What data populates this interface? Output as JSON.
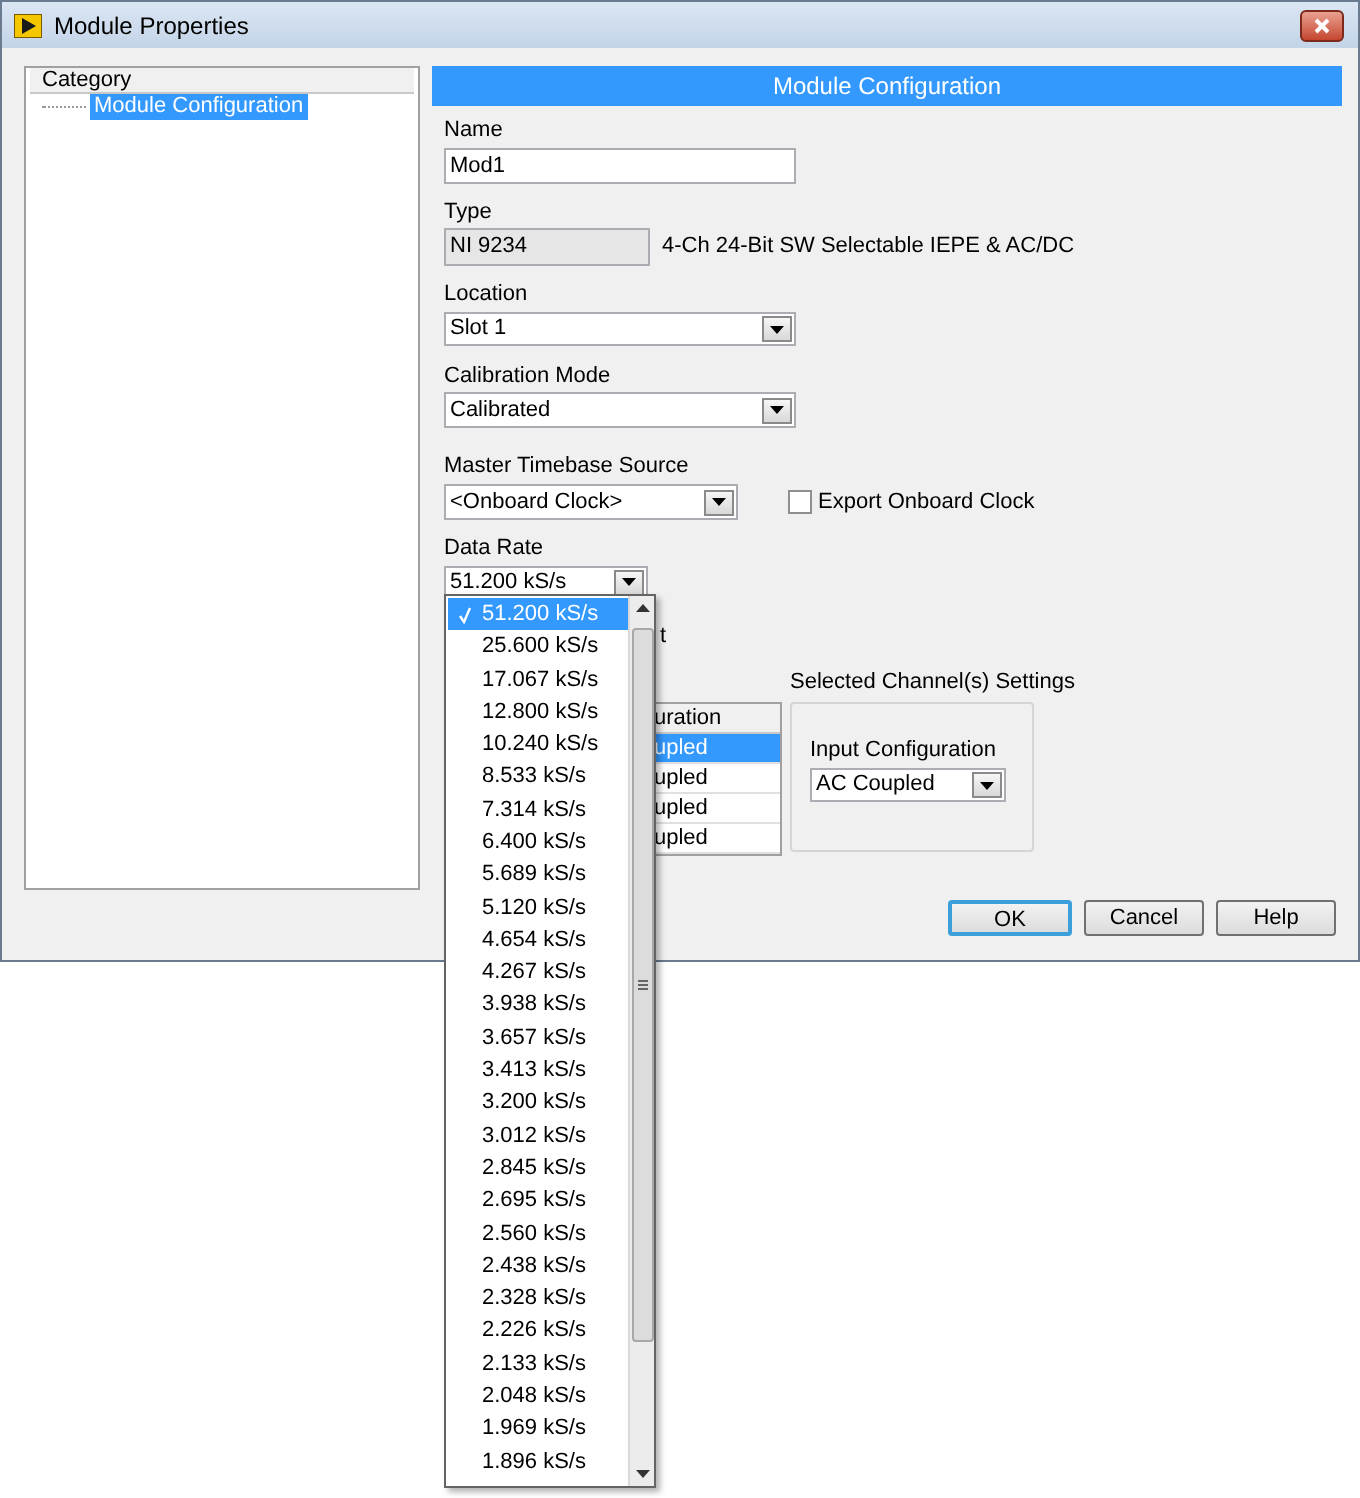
{
  "window": {
    "title": "Module Properties"
  },
  "category_panel": {
    "header": "Category",
    "items": [
      {
        "label": "Module Configuration",
        "selected": true
      }
    ]
  },
  "section_header": "Module Configuration",
  "name": {
    "label": "Name",
    "value": "Mod1"
  },
  "type": {
    "label": "Type",
    "value": "NI 9234",
    "description": "4-Ch 24-Bit SW Selectable IEPE & AC/DC"
  },
  "location": {
    "label": "Location",
    "value": "Slot 1"
  },
  "calibration_mode": {
    "label": "Calibration Mode",
    "value": "Calibrated"
  },
  "master_timebase": {
    "label": "Master Timebase Source",
    "value": "<Onboard Clock>"
  },
  "export_clock": {
    "label": "Export Onboard Clock",
    "checked": false
  },
  "data_rate": {
    "label": "Data Rate",
    "value": "51.200 kS/s",
    "options": [
      {
        "label": "51.200 kS/s",
        "selected": true
      },
      {
        "label": "25.600 kS/s",
        "selected": false
      },
      {
        "label": "17.067 kS/s",
        "selected": false
      },
      {
        "label": "12.800 kS/s",
        "selected": false
      },
      {
        "label": "10.240 kS/s",
        "selected": false
      },
      {
        "label": "8.533 kS/s",
        "selected": false
      },
      {
        "label": "7.314 kS/s",
        "selected": false
      },
      {
        "label": "6.400 kS/s",
        "selected": false
      },
      {
        "label": "5.689 kS/s",
        "selected": false
      },
      {
        "label": "5.120 kS/s",
        "selected": false
      },
      {
        "label": "4.654 kS/s",
        "selected": false
      },
      {
        "label": "4.267 kS/s",
        "selected": false
      },
      {
        "label": "3.938 kS/s",
        "selected": false
      },
      {
        "label": "3.657 kS/s",
        "selected": false
      },
      {
        "label": "3.413 kS/s",
        "selected": false
      },
      {
        "label": "3.200 kS/s",
        "selected": false
      },
      {
        "label": "3.012 kS/s",
        "selected": false
      },
      {
        "label": "2.845 kS/s",
        "selected": false
      },
      {
        "label": "2.695 kS/s",
        "selected": false
      },
      {
        "label": "2.560 kS/s",
        "selected": false
      },
      {
        "label": "2.438 kS/s",
        "selected": false
      },
      {
        "label": "2.328 kS/s",
        "selected": false
      },
      {
        "label": "2.226 kS/s",
        "selected": false
      },
      {
        "label": "2.133 kS/s",
        "selected": false
      },
      {
        "label": "2.048 kS/s",
        "selected": false
      },
      {
        "label": "1.969 kS/s",
        "selected": false
      },
      {
        "label": "1.896 kS/s",
        "selected": false
      }
    ]
  },
  "partial_label": "t",
  "channel_table": {
    "header": "uration",
    "rows": [
      {
        "cell": "upled",
        "selected": true
      },
      {
        "cell": "upled",
        "selected": false
      },
      {
        "cell": "upled",
        "selected": false
      },
      {
        "cell": "upled",
        "selected": false
      }
    ]
  },
  "channel_settings": {
    "title": "Selected Channel(s) Settings",
    "input_configuration": {
      "label": "Input Configuration",
      "value": "AC Coupled"
    }
  },
  "buttons": [
    {
      "label": "OK",
      "default": true
    },
    {
      "label": "Cancel",
      "default": false
    },
    {
      "label": "Help",
      "default": false
    }
  ]
}
